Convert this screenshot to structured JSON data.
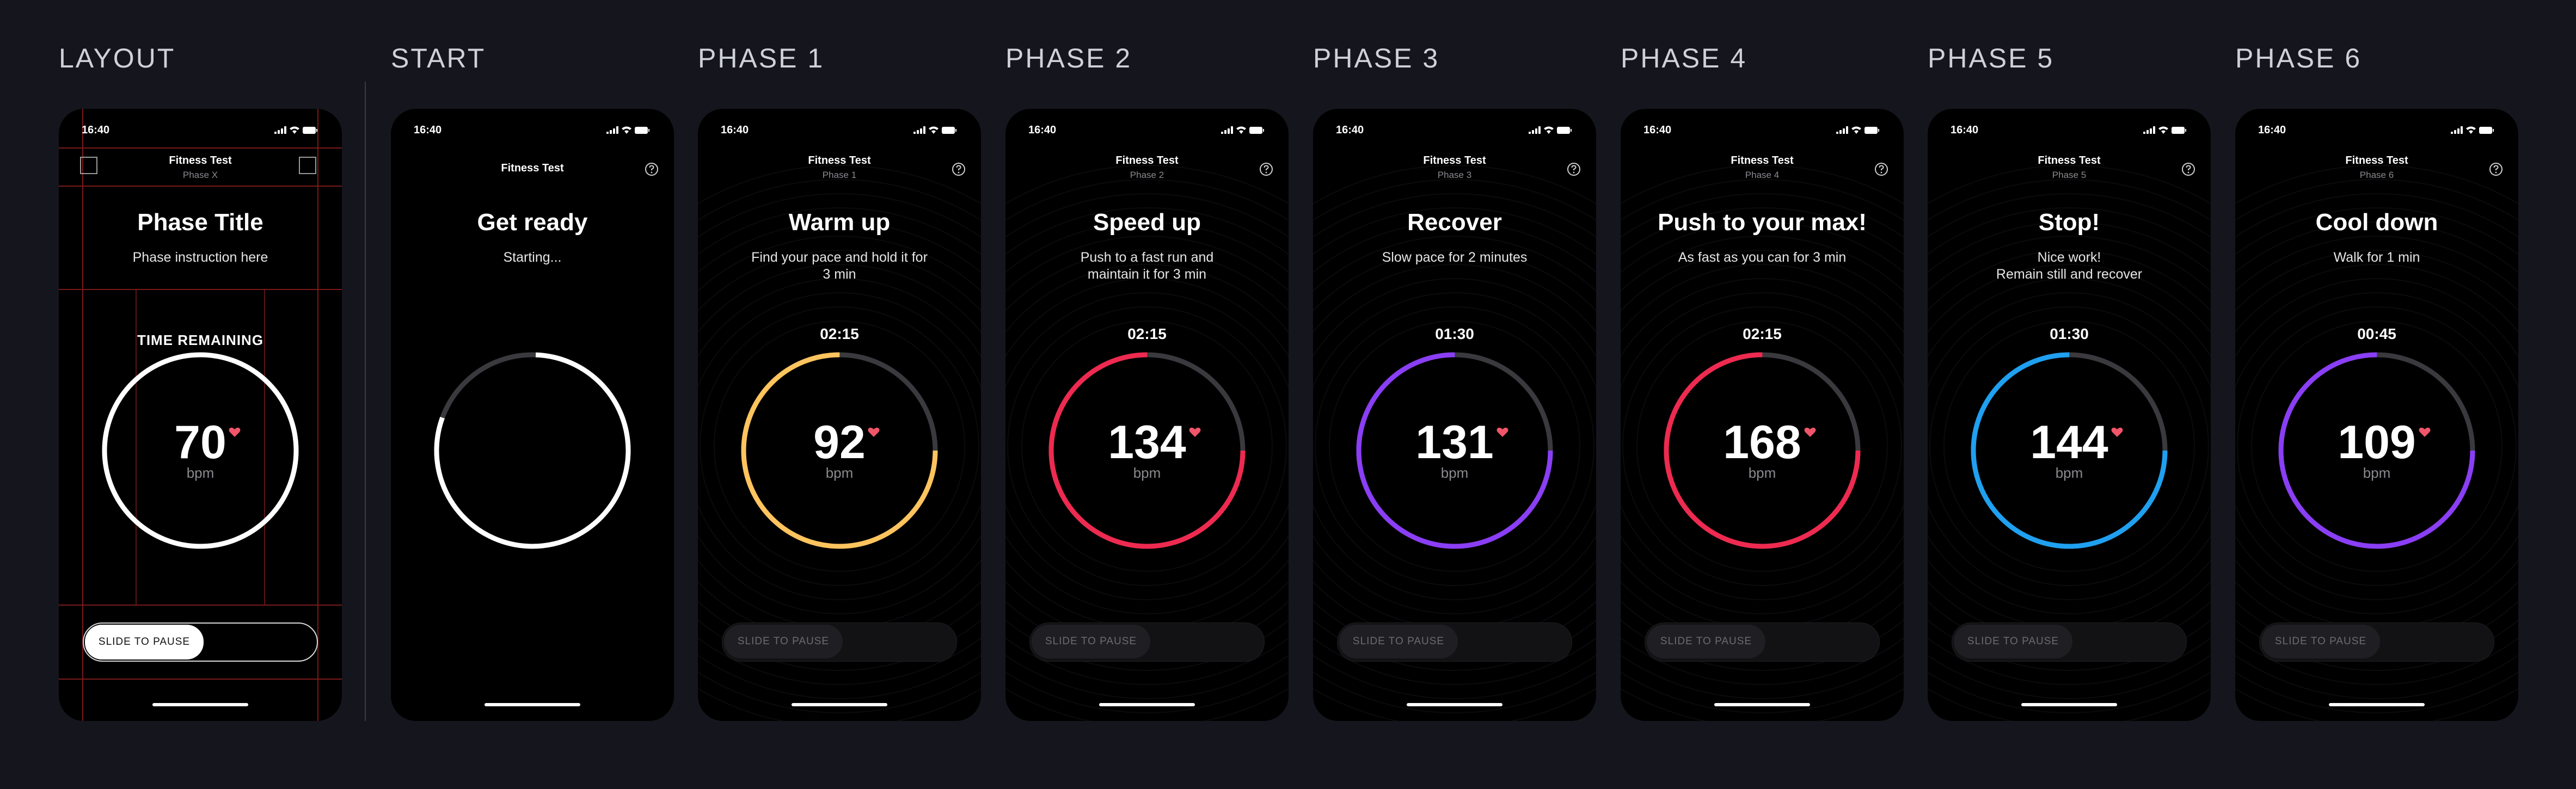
{
  "columns": [
    {
      "label": "LAYOUT",
      "variant": "layout",
      "time": "16:40",
      "nav_title": "Fitness Test",
      "nav_sub": "Phase X",
      "title": "Phase Title",
      "instruction": "Phase instruction here",
      "time_label": "TIME REMAINING",
      "timer": "",
      "bpm": "70",
      "bpm_unit": "bpm",
      "ring_color": "#ffffff",
      "progress": 1.0,
      "slider_label": "SLIDE TO PAUSE"
    },
    {
      "label": "START",
      "variant": "start",
      "time": "16:40",
      "nav_title": "Fitness Test",
      "nav_sub": "",
      "title": "Get ready",
      "instruction": "Starting...",
      "time_label": "",
      "timer": "",
      "bpm": "",
      "bpm_unit": "",
      "ring_color": "#ffffff",
      "progress": 0.8,
      "slider_label": ""
    },
    {
      "label": "PHASE 1",
      "variant": "phase",
      "time": "16:40",
      "nav_title": "Fitness Test",
      "nav_sub": "Phase 1",
      "title": "Warm up",
      "instruction": "Find your pace and hold it for\n3 min",
      "time_label": "",
      "timer": "02:15",
      "bpm": "92",
      "bpm_unit": "bpm",
      "ring_color": "#ffc45e",
      "progress": 0.75,
      "slider_label": "SLIDE TO PAUSE"
    },
    {
      "label": "PHASE 2",
      "variant": "phase",
      "time": "16:40",
      "nav_title": "Fitness Test",
      "nav_sub": "Phase 2",
      "title": "Speed up",
      "instruction": "Push to a fast run and\nmaintain it for 3 min",
      "time_label": "",
      "timer": "02:15",
      "bpm": "134",
      "bpm_unit": "bpm",
      "ring_color": "#ee2a50",
      "progress": 0.75,
      "slider_label": "SLIDE TO PAUSE"
    },
    {
      "label": "PHASE 3",
      "variant": "phase",
      "time": "16:40",
      "nav_title": "Fitness Test",
      "nav_sub": "Phase 3",
      "title": "Recover",
      "instruction": "Slow pace for 2 minutes",
      "time_label": "",
      "timer": "01:30",
      "bpm": "131",
      "bpm_unit": "bpm",
      "ring_color": "#8a3ef5",
      "progress": 0.75,
      "slider_label": "SLIDE TO PAUSE"
    },
    {
      "label": "PHASE 4",
      "variant": "phase",
      "time": "16:40",
      "nav_title": "Fitness Test",
      "nav_sub": "Phase 4",
      "title": "Push to your max!",
      "instruction": "As fast as you can for 3 min",
      "time_label": "",
      "timer": "02:15",
      "bpm": "168",
      "bpm_unit": "bpm",
      "ring_color": "#ee2a50",
      "progress": 0.75,
      "slider_label": "SLIDE TO PAUSE"
    },
    {
      "label": "PHASE 5",
      "variant": "phase",
      "time": "16:40",
      "nav_title": "Fitness Test",
      "nav_sub": "Phase 5",
      "title": "Stop!",
      "instruction": "Nice work!\nRemain still and recover",
      "time_label": "",
      "timer": "01:30",
      "bpm": "144",
      "bpm_unit": "bpm",
      "ring_color": "#1fa0f0",
      "progress": 0.75,
      "slider_label": "SLIDE TO PAUSE"
    },
    {
      "label": "PHASE 6",
      "variant": "phase",
      "time": "16:40",
      "nav_title": "Fitness Test",
      "nav_sub": "Phase 6",
      "title": "Cool down",
      "instruction": "Walk for 1 min",
      "time_label": "",
      "timer": "00:45",
      "bpm": "109",
      "bpm_unit": "bpm",
      "ring_color": "#8a3ef5",
      "progress": 0.75,
      "slider_label": "SLIDE TO PAUSE"
    }
  ],
  "icons": {
    "status": [
      "signal-icon",
      "wifi-icon",
      "battery-icon"
    ],
    "help": "help-icon",
    "heart": "heart-icon"
  },
  "colors": {
    "background": "#15161d",
    "heart": "#f0556a",
    "track": "#3a3a3e"
  }
}
